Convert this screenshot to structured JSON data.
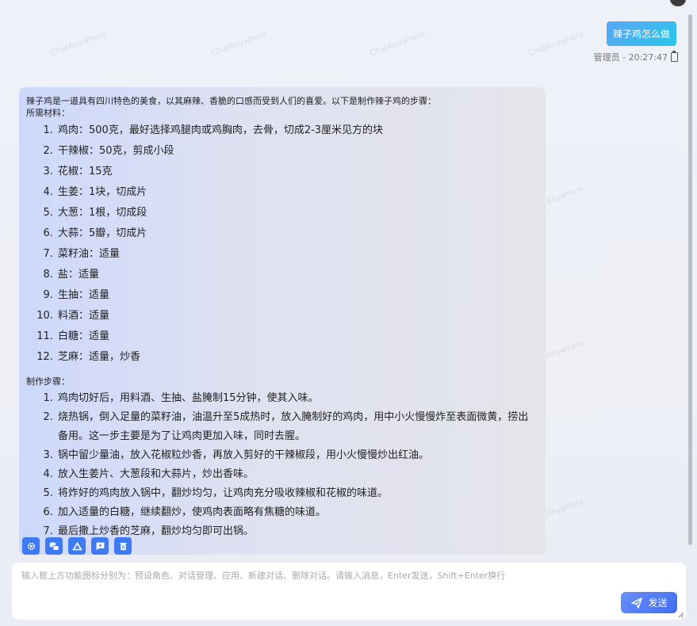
{
  "watermark_text": "ChatAnywhere",
  "user_message": {
    "text": "辣子鸡怎么做",
    "meta": "管理员 - 20:27:47"
  },
  "assistant_message": {
    "intro": "辣子鸡是一道具有四川特色的美食，以其麻辣、香脆的口感而受到人们的喜爱。以下是制作辣子鸡的步骤：",
    "ingredients_title": "所需材料：",
    "ingredients": [
      "鸡肉：500克，最好选择鸡腿肉或鸡胸肉，去骨，切成2-3厘米见方的块",
      "干辣椒：50克，剪成小段",
      "花椒：15克",
      "生姜：1块，切成片",
      "大葱：1根，切成段",
      "大蒜：5瓣，切成片",
      "菜籽油：适量",
      "盐：适量",
      "生抽：适量",
      "料酒：适量",
      "白糖：适量",
      "芝麻：适量，炒香"
    ],
    "steps_title": "制作步骤：",
    "steps": [
      "鸡肉切好后，用料酒、生抽、盐腌制15分钟，使其入味。",
      "烧热锅，倒入足量的菜籽油，油温升至5成热时，放入腌制好的鸡肉，用中小火慢慢炸至表面微黄，捞出备用。这一步主要是为了让鸡肉更加入味，同时去腥。",
      "锅中留少量油，放入花椒粒炒香，再放入剪好的干辣椒段，用小火慢慢炒出红油。",
      "放入生姜片、大葱段和大蒜片，炒出香味。",
      "将炸好的鸡肉放入锅中，翻炒均匀，让鸡肉充分吸收辣椒和花椒的味道。",
      "加入适量的白糖，继续翻炒，使鸡肉表面略有焦糖的味道。",
      "最后撒上炒香的芝麻，翻炒均匀即可出锅。"
    ]
  },
  "toolbar": {
    "icons": [
      "gear-icon",
      "chat-manage-icon",
      "apps-icon",
      "new-chat-icon",
      "delete-icon"
    ]
  },
  "input": {
    "placeholder": "输入框上方功能图标分别为：预设角色、对话管理、应用、新建对话、删除对话。请输入消息，Enter发送，Shift+Enter换行",
    "value": ""
  },
  "send_button": {
    "label": "发送"
  },
  "colors": {
    "accent": "#3f7af5",
    "user_bubble_start": "#5aa6f8",
    "user_bubble_end": "#2bc6e6"
  }
}
